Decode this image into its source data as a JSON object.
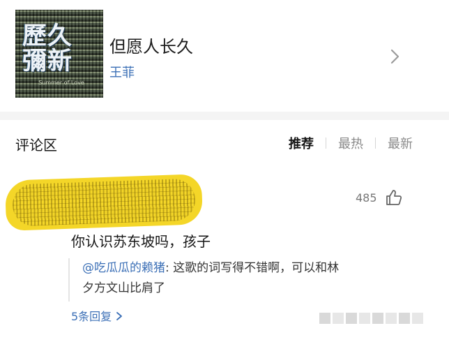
{
  "song": {
    "title": "但愿人长久",
    "artist": "王菲",
    "cover": {
      "title": "歷久 彌新",
      "subtitle": "Summer of Love"
    }
  },
  "comments": {
    "header": "评论区",
    "sort_tabs": [
      {
        "label": "推荐",
        "active": true
      },
      {
        "label": "最热",
        "active": false
      },
      {
        "label": "最新",
        "active": false
      }
    ]
  },
  "comment": {
    "like_count": "485",
    "text": "你认识苏东坡吗，孩子",
    "reply": {
      "user": "@吃瓜瓜的赖猪",
      "text_line1": ": 这歌的词写得不错啊，可以和林",
      "text_line2": "夕方文山比肩了"
    },
    "reply_count_label": "5条回复"
  },
  "colors": {
    "link": "#3b6fb6",
    "highlight_redaction": "#f4d628",
    "muted": "#8a8a8a"
  },
  "icons": [
    "chevron-right-icon",
    "thumbs-up-icon"
  ]
}
